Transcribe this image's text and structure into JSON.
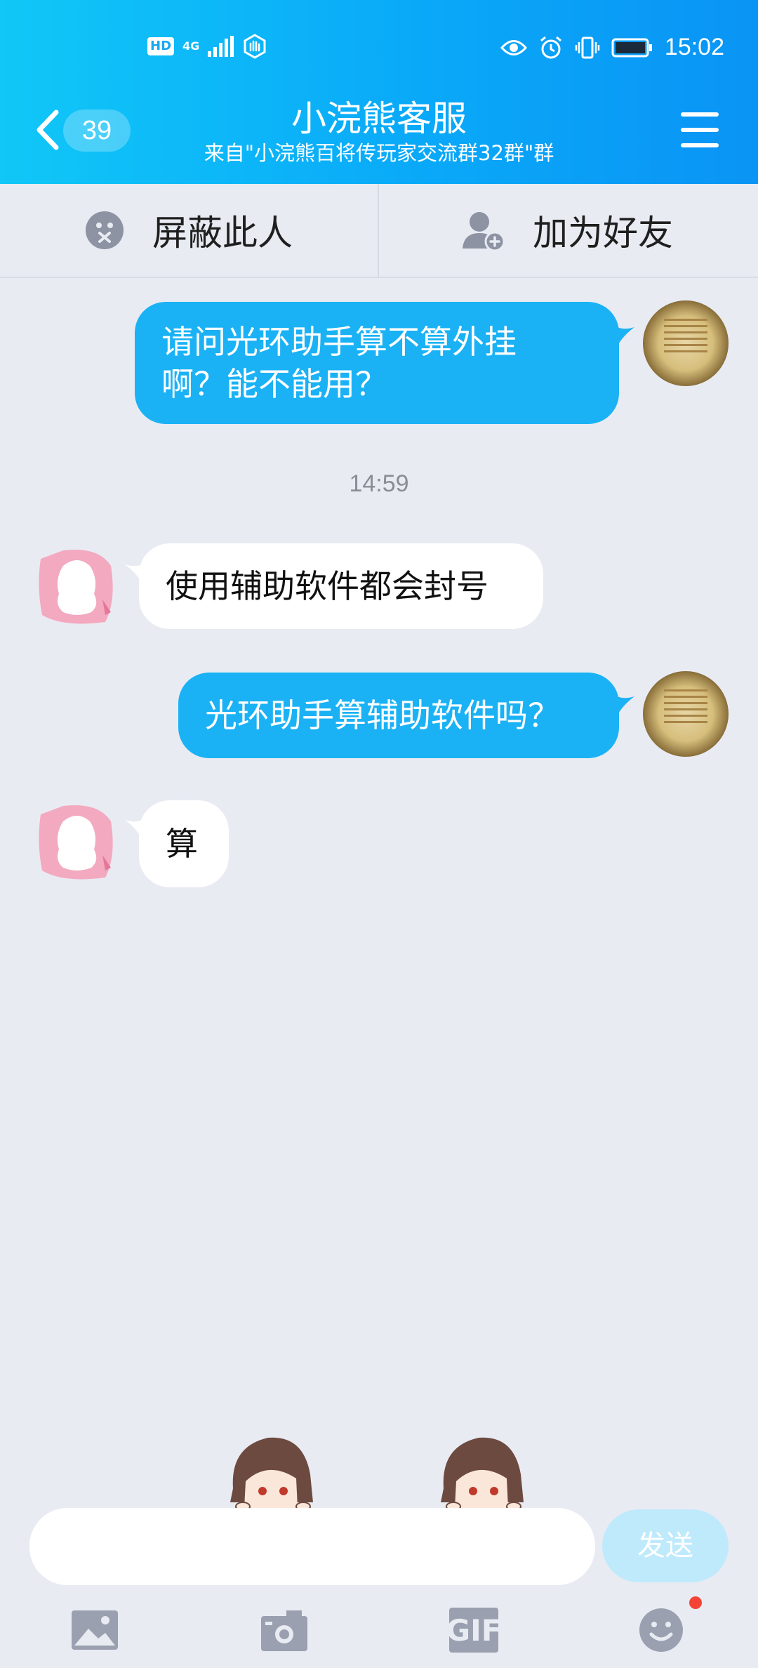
{
  "status_bar": {
    "hd": "HD",
    "network": "4G",
    "time": "15:02"
  },
  "header": {
    "unread_count": "39",
    "title": "小浣熊客服",
    "subtitle": "来自\"小浣熊百将传玩家交流群32群\"群"
  },
  "actions": {
    "block_label": "屏蔽此人",
    "add_friend_label": "加为好友"
  },
  "messages": [
    {
      "direction": "out",
      "text": "请问光环助手算不算外挂\n啊？能不能用？"
    },
    {
      "direction": "in",
      "text": "使用辅助软件都会封号"
    },
    {
      "direction": "out",
      "text": "光环助手算辅助软件吗？"
    },
    {
      "direction": "in",
      "text": "算"
    }
  ],
  "timestamp": "14:59",
  "composer": {
    "input_value": "",
    "send_label": "发送"
  },
  "toolbar": {
    "gif_label": "GIF"
  },
  "colors": {
    "header": "#0aa9f8",
    "outgoing_bubble": "#1ab2f5",
    "incoming_bubble": "#ffffff",
    "background": "#e9ebf3",
    "notification_dot": "#f44336"
  }
}
